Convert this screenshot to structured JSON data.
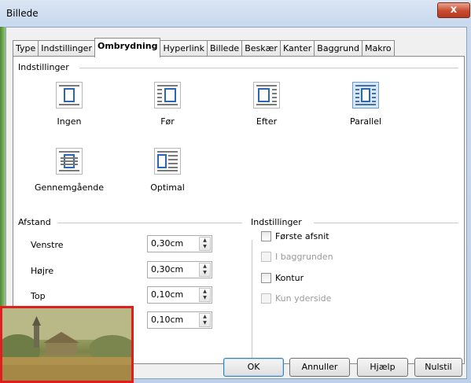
{
  "window": {
    "title": "Billede",
    "close_label": "x"
  },
  "tabs": [
    "Type",
    "Indstillinger",
    "Ombrydning",
    "Hyperlink",
    "Billede",
    "Beskær",
    "Kanter",
    "Baggrund",
    "Makro"
  ],
  "active_tab": "Ombrydning",
  "wrap_group": {
    "heading": "Indstillinger",
    "options": [
      {
        "label": "Ingen",
        "icon": "wrap-none-icon",
        "selected": false
      },
      {
        "label": "Før",
        "icon": "wrap-before-icon",
        "selected": false
      },
      {
        "label": "Efter",
        "icon": "wrap-after-icon",
        "selected": false
      },
      {
        "label": "Parallel",
        "icon": "wrap-parallel-icon",
        "selected": true
      },
      {
        "label": "Gennemgående",
        "icon": "wrap-through-icon",
        "selected": false
      },
      {
        "label": "Optimal",
        "icon": "wrap-optimal-icon",
        "selected": false
      }
    ]
  },
  "spacing": {
    "heading": "Afstand",
    "fields": [
      {
        "label": "Venstre",
        "value": "0,30cm"
      },
      {
        "label": "Højre",
        "value": "0,30cm"
      },
      {
        "label": "Top",
        "value": "0,10cm"
      },
      {
        "label": "",
        "value": "0,10cm"
      }
    ]
  },
  "options": {
    "heading": "Indstillinger",
    "checkboxes": [
      {
        "label": "Første afsnit",
        "checked": false,
        "enabled": true
      },
      {
        "label": "I baggrunden",
        "checked": false,
        "enabled": false
      },
      {
        "label": "Kontur",
        "checked": false,
        "enabled": true
      },
      {
        "label": "Kun yderside",
        "checked": false,
        "enabled": false
      }
    ]
  },
  "buttons": {
    "ok": "OK",
    "cancel": "Annuller",
    "help": "Hjælp",
    "reset": "Nulstil"
  },
  "colors": {
    "selected_fill": "#d6e7fb",
    "selected_border": "#6b9ad6",
    "thumbnail_border": "#e01e1e"
  }
}
